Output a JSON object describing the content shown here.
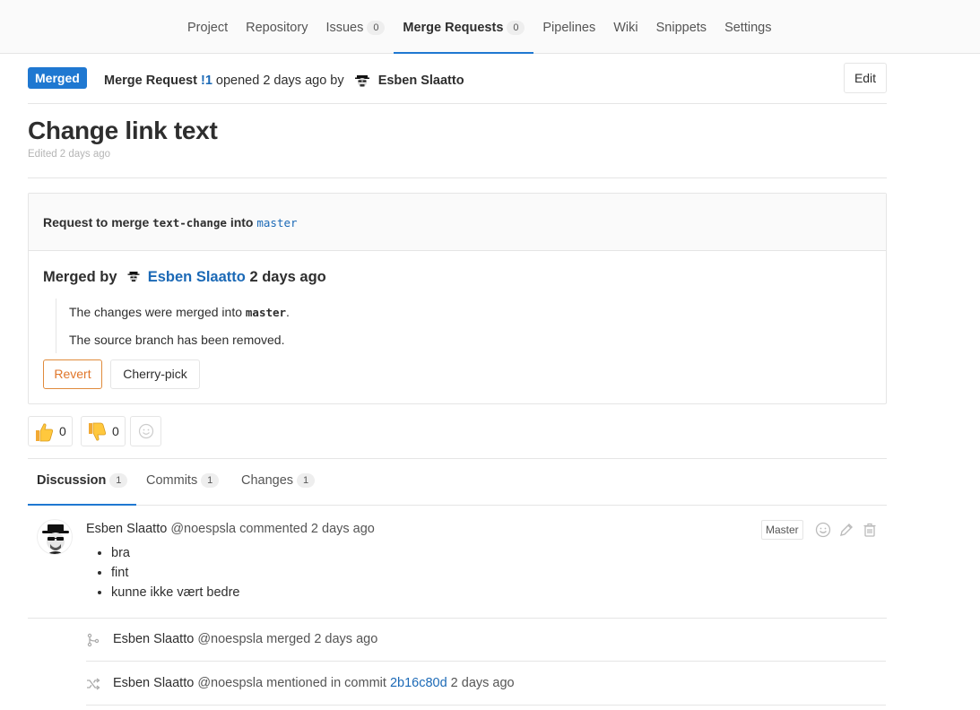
{
  "nav": {
    "items": [
      {
        "label": "Project",
        "count": ""
      },
      {
        "label": "Repository",
        "count": ""
      },
      {
        "label": "Issues",
        "count": "0"
      },
      {
        "label": "Merge Requests",
        "count": "0"
      },
      {
        "label": "Pipelines",
        "count": ""
      },
      {
        "label": "Wiki",
        "count": ""
      },
      {
        "label": "Snippets",
        "count": ""
      },
      {
        "label": "Settings",
        "count": ""
      }
    ],
    "active": "Merge Requests"
  },
  "header": {
    "status": "Merged",
    "prefix": "Merge Request",
    "iid": "!1",
    "opened": "opened 2 days ago by",
    "author": "Esben Slaatto",
    "edit_label": "Edit"
  },
  "title": "Change link text",
  "edited": "Edited 2 days ago",
  "widget": {
    "request_prefix": "Request to merge",
    "source_branch": "text-change",
    "into": "into",
    "target_branch": "master",
    "merged_by_label": "Merged by",
    "merged_by_user": "Esben Slaatto",
    "merged_when": "2 days ago",
    "note1_prefix": "The changes were merged into",
    "note1_branch": "master",
    "note1_suffix": ".",
    "note2": "The source branch has been removed.",
    "revert_label": "Revert",
    "cherry_label": "Cherry-pick"
  },
  "awards": {
    "thumbsup_count": "0",
    "thumbsdown_count": "0"
  },
  "tabs": [
    {
      "label": "Discussion",
      "count": "1"
    },
    {
      "label": "Commits",
      "count": "1"
    },
    {
      "label": "Changes",
      "count": "1"
    }
  ],
  "note": {
    "author": "Esben Slaatto",
    "handle": "@noespsla",
    "action": "commented 2 days ago",
    "role": "Master",
    "items": [
      "bra",
      "fint",
      "kunne ikke vært bedre"
    ]
  },
  "system_notes": [
    {
      "author": "Esben Slaatto",
      "handle": "@noespsla",
      "text": "merged 2 days ago",
      "commit": "",
      "after": ""
    },
    {
      "author": "Esben Slaatto",
      "handle": "@noespsla",
      "text": "mentioned in commit",
      "commit": "2b16c80d",
      "after": "2 days ago"
    }
  ],
  "colors": {
    "accent": "#1f78d1",
    "link": "#1b69b6",
    "revert": "#e0762a",
    "border": "#e5e5e5"
  }
}
